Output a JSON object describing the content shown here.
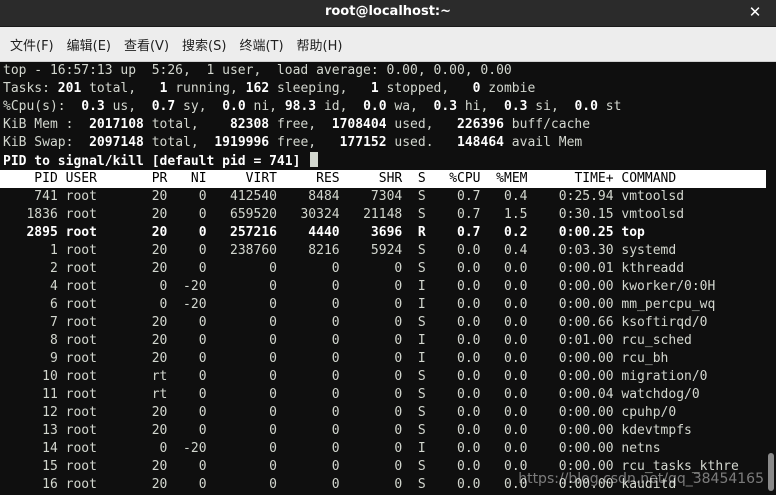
{
  "window": {
    "title": "root@localhost:~",
    "close_glyph": "✕"
  },
  "menu": [
    "文件(F)",
    "编辑(E)",
    "查看(V)",
    "搜索(S)",
    "终端(T)",
    "帮助(H)"
  ],
  "summary": {
    "line1": "top - 16:57:13 up  5:26,  1 user,  load average: 0.00, 0.00, 0.00",
    "tasks": {
      "prefix": "Tasks: ",
      "total": "201",
      "t1": " total,   ",
      "running": "1",
      "t2": " running, ",
      "sleeping": "162",
      "t3": " sleeping,   ",
      "stopped": "1",
      "t4": " stopped,   ",
      "zombie": "0",
      "t5": " zombie"
    },
    "cpu": {
      "prefix": "%Cpu(s):  ",
      "us": "0.3",
      "a": " us,  ",
      "sy": "0.7",
      "b": " sy,  ",
      "ni": "0.0",
      "c": " ni, ",
      "id": "98.3",
      "d": " id,  ",
      "wa": "0.0",
      "e": " wa,  ",
      "hi": "0.3",
      "f": " hi,  ",
      "si": "0.3",
      "g": " si,  ",
      "st": "0.0",
      "h": " st"
    },
    "mem": {
      "prefix": "KiB Mem :  ",
      "total": "2017108",
      "a": " total,    ",
      "free": "82308",
      "b": " free,  ",
      "used": "1708404",
      "c": " used,   ",
      "cache": "226396",
      "d": " buff/cache"
    },
    "swap": {
      "prefix": "KiB Swap:  ",
      "total": "2097148",
      "a": " total,  ",
      "free": "1919996",
      "b": " free,   ",
      "used": "177152",
      "c": " used.   ",
      "avail": "148464",
      "d": " avail Mem"
    },
    "prompt": "PID to signal/kill [default pid = 741] "
  },
  "table": {
    "columns": [
      "PID",
      "USER",
      "PR",
      "NI",
      "VIRT",
      "RES",
      "SHR",
      "S",
      "%CPU",
      "%MEM",
      "TIME+",
      "COMMAND"
    ],
    "rows": [
      {
        "pid": "741",
        "user": "root",
        "pr": "20",
        "ni": "0",
        "virt": "412540",
        "res": "8484",
        "shr": "7304",
        "s": "S",
        "cpu": "0.7",
        "mem": "0.4",
        "time": "0:25.94",
        "cmd": "vmtoolsd",
        "bold": false
      },
      {
        "pid": "1836",
        "user": "root",
        "pr": "20",
        "ni": "0",
        "virt": "659520",
        "res": "30324",
        "shr": "21148",
        "s": "S",
        "cpu": "0.7",
        "mem": "1.5",
        "time": "0:30.15",
        "cmd": "vmtoolsd",
        "bold": false
      },
      {
        "pid": "2895",
        "user": "root",
        "pr": "20",
        "ni": "0",
        "virt": "257216",
        "res": "4440",
        "shr": "3696",
        "s": "R",
        "cpu": "0.7",
        "mem": "0.2",
        "time": "0:00.25",
        "cmd": "top",
        "bold": true
      },
      {
        "pid": "1",
        "user": "root",
        "pr": "20",
        "ni": "0",
        "virt": "238760",
        "res": "8216",
        "shr": "5924",
        "s": "S",
        "cpu": "0.0",
        "mem": "0.4",
        "time": "0:03.30",
        "cmd": "systemd",
        "bold": false
      },
      {
        "pid": "2",
        "user": "root",
        "pr": "20",
        "ni": "0",
        "virt": "0",
        "res": "0",
        "shr": "0",
        "s": "S",
        "cpu": "0.0",
        "mem": "0.0",
        "time": "0:00.01",
        "cmd": "kthreadd",
        "bold": false
      },
      {
        "pid": "4",
        "user": "root",
        "pr": "0",
        "ni": "-20",
        "virt": "0",
        "res": "0",
        "shr": "0",
        "s": "I",
        "cpu": "0.0",
        "mem": "0.0",
        "time": "0:00.00",
        "cmd": "kworker/0:0H",
        "bold": false
      },
      {
        "pid": "6",
        "user": "root",
        "pr": "0",
        "ni": "-20",
        "virt": "0",
        "res": "0",
        "shr": "0",
        "s": "I",
        "cpu": "0.0",
        "mem": "0.0",
        "time": "0:00.00",
        "cmd": "mm_percpu_wq",
        "bold": false
      },
      {
        "pid": "7",
        "user": "root",
        "pr": "20",
        "ni": "0",
        "virt": "0",
        "res": "0",
        "shr": "0",
        "s": "S",
        "cpu": "0.0",
        "mem": "0.0",
        "time": "0:00.66",
        "cmd": "ksoftirqd/0",
        "bold": false
      },
      {
        "pid": "8",
        "user": "root",
        "pr": "20",
        "ni": "0",
        "virt": "0",
        "res": "0",
        "shr": "0",
        "s": "I",
        "cpu": "0.0",
        "mem": "0.0",
        "time": "0:01.00",
        "cmd": "rcu_sched",
        "bold": false
      },
      {
        "pid": "9",
        "user": "root",
        "pr": "20",
        "ni": "0",
        "virt": "0",
        "res": "0",
        "shr": "0",
        "s": "I",
        "cpu": "0.0",
        "mem": "0.0",
        "time": "0:00.00",
        "cmd": "rcu_bh",
        "bold": false
      },
      {
        "pid": "10",
        "user": "root",
        "pr": "rt",
        "ni": "0",
        "virt": "0",
        "res": "0",
        "shr": "0",
        "s": "S",
        "cpu": "0.0",
        "mem": "0.0",
        "time": "0:00.00",
        "cmd": "migration/0",
        "bold": false
      },
      {
        "pid": "11",
        "user": "root",
        "pr": "rt",
        "ni": "0",
        "virt": "0",
        "res": "0",
        "shr": "0",
        "s": "S",
        "cpu": "0.0",
        "mem": "0.0",
        "time": "0:00.04",
        "cmd": "watchdog/0",
        "bold": false
      },
      {
        "pid": "12",
        "user": "root",
        "pr": "20",
        "ni": "0",
        "virt": "0",
        "res": "0",
        "shr": "0",
        "s": "S",
        "cpu": "0.0",
        "mem": "0.0",
        "time": "0:00.00",
        "cmd": "cpuhp/0",
        "bold": false
      },
      {
        "pid": "13",
        "user": "root",
        "pr": "20",
        "ni": "0",
        "virt": "0",
        "res": "0",
        "shr": "0",
        "s": "S",
        "cpu": "0.0",
        "mem": "0.0",
        "time": "0:00.00",
        "cmd": "kdevtmpfs",
        "bold": false
      },
      {
        "pid": "14",
        "user": "root",
        "pr": "0",
        "ni": "-20",
        "virt": "0",
        "res": "0",
        "shr": "0",
        "s": "I",
        "cpu": "0.0",
        "mem": "0.0",
        "time": "0:00.00",
        "cmd": "netns",
        "bold": false
      },
      {
        "pid": "15",
        "user": "root",
        "pr": "20",
        "ni": "0",
        "virt": "0",
        "res": "0",
        "shr": "0",
        "s": "S",
        "cpu": "0.0",
        "mem": "0.0",
        "time": "0:00.00",
        "cmd": "rcu_tasks_kthre",
        "bold": false
      },
      {
        "pid": "16",
        "user": "root",
        "pr": "20",
        "ni": "0",
        "virt": "0",
        "res": "0",
        "shr": "0",
        "s": "S",
        "cpu": "0.0",
        "mem": "0.0",
        "time": "0:00.00",
        "cmd": "kauditd",
        "bold": false
      }
    ]
  },
  "watermark": "https://blog.csdn.net/qq_38454165"
}
